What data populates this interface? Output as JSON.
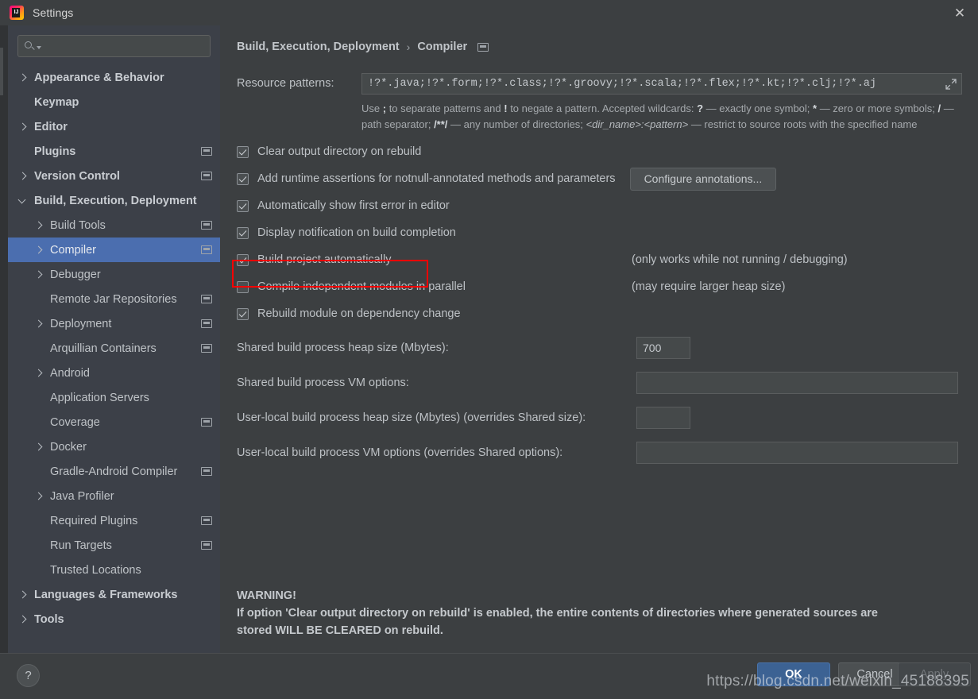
{
  "window": {
    "title": "Settings",
    "logo_icon": "intellij-idea-logo",
    "close_icon": "close-icon"
  },
  "sidebar": {
    "search": {
      "value": "",
      "placeholder": "",
      "icon": "search-icon"
    },
    "items": [
      {
        "label": "Appearance & Behavior",
        "arrow": "right",
        "bold": true,
        "indent": 12,
        "module_icon": false,
        "selected": false
      },
      {
        "label": "Keymap",
        "arrow": "none",
        "bold": true,
        "indent": 12,
        "module_icon": false,
        "selected": false
      },
      {
        "label": "Editor",
        "arrow": "right",
        "bold": true,
        "indent": 12,
        "module_icon": false,
        "selected": false
      },
      {
        "label": "Plugins",
        "arrow": "none",
        "bold": true,
        "indent": 12,
        "module_icon": true,
        "selected": false
      },
      {
        "label": "Version Control",
        "arrow": "right",
        "bold": true,
        "indent": 12,
        "module_icon": true,
        "selected": false
      },
      {
        "label": "Build, Execution, Deployment",
        "arrow": "down",
        "bold": true,
        "indent": 12,
        "module_icon": false,
        "selected": false
      },
      {
        "label": "Build Tools",
        "arrow": "right",
        "bold": false,
        "indent": 32,
        "module_icon": true,
        "selected": false
      },
      {
        "label": "Compiler",
        "arrow": "right",
        "bold": false,
        "indent": 32,
        "module_icon": true,
        "selected": true
      },
      {
        "label": "Debugger",
        "arrow": "right",
        "bold": false,
        "indent": 32,
        "module_icon": false,
        "selected": false
      },
      {
        "label": "Remote Jar Repositories",
        "arrow": "none",
        "bold": false,
        "indent": 32,
        "module_icon": true,
        "selected": false
      },
      {
        "label": "Deployment",
        "arrow": "right",
        "bold": false,
        "indent": 32,
        "module_icon": true,
        "selected": false
      },
      {
        "label": "Arquillian Containers",
        "arrow": "none",
        "bold": false,
        "indent": 32,
        "module_icon": true,
        "selected": false
      },
      {
        "label": "Android",
        "arrow": "right",
        "bold": false,
        "indent": 32,
        "module_icon": false,
        "selected": false
      },
      {
        "label": "Application Servers",
        "arrow": "none",
        "bold": false,
        "indent": 32,
        "module_icon": false,
        "selected": false
      },
      {
        "label": "Coverage",
        "arrow": "none",
        "bold": false,
        "indent": 32,
        "module_icon": true,
        "selected": false
      },
      {
        "label": "Docker",
        "arrow": "right",
        "bold": false,
        "indent": 32,
        "module_icon": false,
        "selected": false
      },
      {
        "label": "Gradle-Android Compiler",
        "arrow": "none",
        "bold": false,
        "indent": 32,
        "module_icon": true,
        "selected": false
      },
      {
        "label": "Java Profiler",
        "arrow": "right",
        "bold": false,
        "indent": 32,
        "module_icon": false,
        "selected": false
      },
      {
        "label": "Required Plugins",
        "arrow": "none",
        "bold": false,
        "indent": 32,
        "module_icon": true,
        "selected": false
      },
      {
        "label": "Run Targets",
        "arrow": "none",
        "bold": false,
        "indent": 32,
        "module_icon": true,
        "selected": false
      },
      {
        "label": "Trusted Locations",
        "arrow": "none",
        "bold": false,
        "indent": 32,
        "module_icon": false,
        "selected": false
      },
      {
        "label": "Languages & Frameworks",
        "arrow": "right",
        "bold": true,
        "indent": 12,
        "module_icon": false,
        "selected": false
      },
      {
        "label": "Tools",
        "arrow": "right",
        "bold": true,
        "indent": 12,
        "module_icon": false,
        "selected": false
      }
    ]
  },
  "main": {
    "breadcrumb": {
      "parent": "Build, Execution, Deployment",
      "separator": "›",
      "current": "Compiler",
      "module_icon": "module-scope-icon"
    },
    "resource_patterns": {
      "label": "Resource patterns:",
      "value": "!?*.java;!?*.form;!?*.class;!?*.groovy;!?*.scala;!?*.flex;!?*.kt;!?*.clj;!?*.aj",
      "expand_icon": "expand-icon"
    },
    "hint": {
      "p1": "Use ",
      "b1": ";",
      "p2": " to separate patterns and ",
      "b2": "!",
      "p3": " to negate a pattern. Accepted wildcards: ",
      "b3": "?",
      "p4": " — exactly one symbol; ",
      "b4": "*",
      "p5": " — zero or more symbols; ",
      "b5": "/",
      "p6": " — path separator; ",
      "b6": "/**/",
      "p7": " — any number of directories; ",
      "i1": "<dir_name>:<pattern>",
      "p8": " — restrict to source roots with the specified name"
    },
    "checkboxes": [
      {
        "label": "Clear output directory on rebuild",
        "checked": true,
        "note": "",
        "button": ""
      },
      {
        "label": "Add runtime assertions for notnull-annotated methods and parameters",
        "checked": true,
        "note": "",
        "button": "Configure annotations..."
      },
      {
        "label": "Automatically show first error in editor",
        "checked": true,
        "note": "",
        "button": ""
      },
      {
        "label": "Display notification on build completion",
        "checked": true,
        "note": "",
        "button": ""
      },
      {
        "label": "Build project automatically",
        "checked": true,
        "note": "(only works while not running / debugging)",
        "button": ""
      },
      {
        "label": "Compile independent modules in parallel",
        "checked": false,
        "note": "(may require larger heap size)",
        "button": ""
      },
      {
        "label": "Rebuild module on dependency change",
        "checked": true,
        "note": "",
        "button": ""
      }
    ],
    "fields": [
      {
        "label": "Shared build process heap size (Mbytes):",
        "value": "700",
        "size": "small"
      },
      {
        "label": "Shared build process VM options:",
        "value": "",
        "size": "wide"
      },
      {
        "label": "User-local build process heap size (Mbytes) (overrides Shared size):",
        "value": "",
        "size": "small"
      },
      {
        "label": "User-local build process VM options (overrides Shared options):",
        "value": "",
        "size": "wide"
      }
    ],
    "warning": {
      "title": "WARNING!",
      "line1": "If option 'Clear output directory on rebuild' is enabled, the entire contents of directories where generated sources are",
      "line2": "stored WILL BE CLEARED on rebuild."
    }
  },
  "footer": {
    "help_label": "?",
    "ok_label": "OK",
    "cancel_label": "Cancel",
    "apply_label": "Apply"
  },
  "watermark": "https://blog.csdn.net/weixin_45188395",
  "colors": {
    "selection": "#4b6eaf",
    "accent_ok": "#3c6293",
    "highlight_box": "#ff0000",
    "sidebar_bg": "#3c4048",
    "content_bg": "#3c3f41"
  }
}
